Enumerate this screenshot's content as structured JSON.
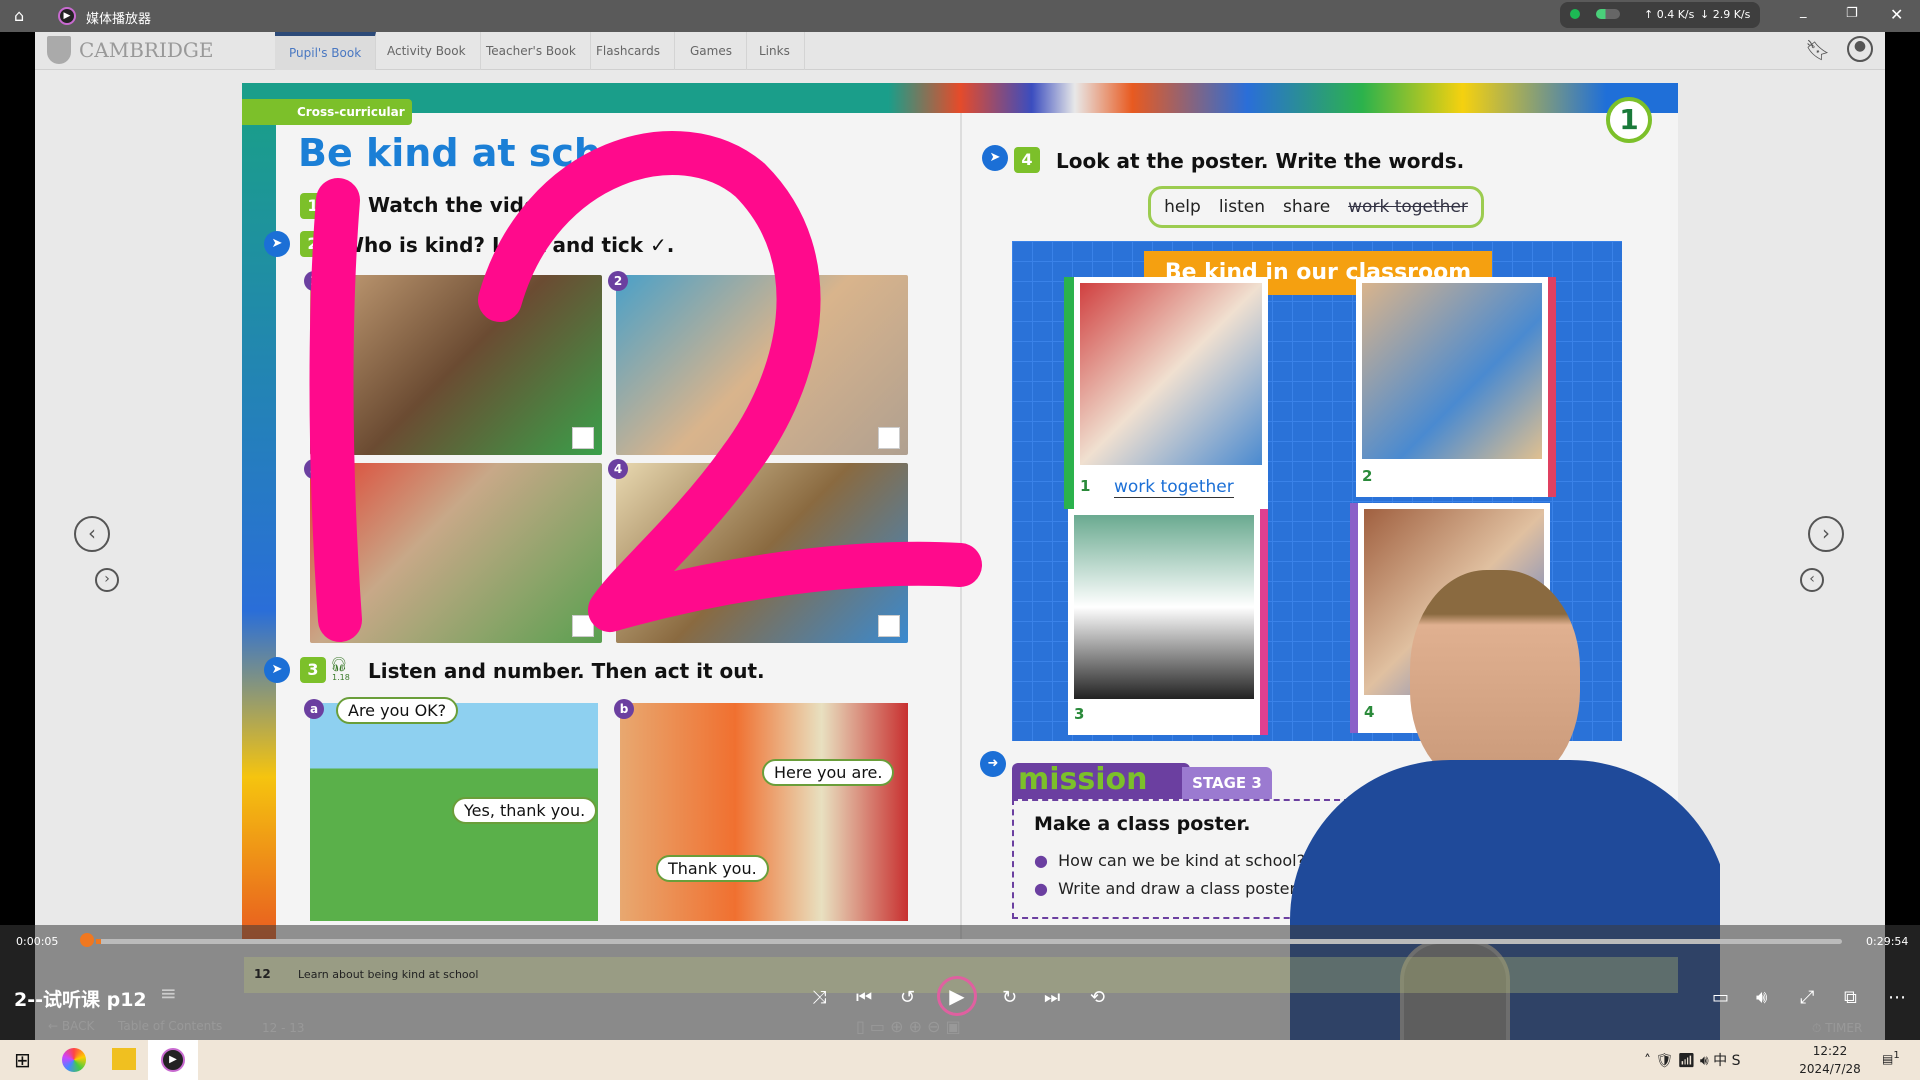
{
  "titlebar": {
    "app_title": "媒体播放器",
    "upload": "0.4",
    "download": "2.9",
    "unit": "K/s"
  },
  "header": {
    "logo": "CAMBRIDGE",
    "tabs": [
      {
        "label": "Pupil's Book",
        "active": true
      },
      {
        "label": "Activity Book"
      },
      {
        "label": "Teacher's Book"
      },
      {
        "label": "Flashcards"
      },
      {
        "label": "Games"
      },
      {
        "label": "Links"
      }
    ]
  },
  "book": {
    "left": {
      "tag": "Cross-curricular",
      "title": "Be kind at scho",
      "ex1": "Watch the video",
      "ex1_num": "1",
      "ex2": "Who is kind? Look and tick ✓.",
      "ex2_num": "2",
      "photos": [
        "1",
        "2",
        "3",
        "4"
      ],
      "ex3_num": "3",
      "ex3_audio": "1.18",
      "ex3": "Listen and number. Then act it out.",
      "scene_a": {
        "label": "a",
        "bubbles": [
          "Are you OK?",
          "Yes, thank you."
        ]
      },
      "scene_b": {
        "label": "b",
        "bubbles": [
          "Here you are.",
          "Thank you."
        ]
      },
      "page_number": "12",
      "footer": "Learn about being kind at school"
    },
    "right": {
      "unit_badge": "1",
      "ex4_num": "4",
      "ex4": "Look at the poster. Write the words.",
      "words": [
        "help",
        "listen",
        "share",
        "work together"
      ],
      "struck_word": "work together",
      "poster_title": "Be kind in our classroom",
      "poster_items": [
        {
          "n": "1",
          "answer": "work together"
        },
        {
          "n": "2",
          "answer": ""
        },
        {
          "n": "3",
          "answer": ""
        },
        {
          "n": "4",
          "answer": ""
        }
      ],
      "mission": "mission",
      "stage": "STAGE 3",
      "mission_title": "Make a class poster.",
      "mission_bullets": [
        "How can we be kind at school? Say",
        "Write and draw a class poster."
      ]
    }
  },
  "annotation": "12",
  "player": {
    "elapsed": "0:00:05",
    "duration": "0:29:54",
    "progress_percent": 0.3,
    "video_title": "2--试听课 p12"
  },
  "viewer_toolbar": {
    "back": "BACK",
    "toc": "Table of Contents",
    "pages": "12 - 13",
    "timer": "TIMER"
  },
  "taskbar": {
    "time": "12:22",
    "date": "2024/7/28",
    "notif": "1"
  },
  "colors": {
    "accent": "#1b7fd6",
    "annotation": "#ff0a8c",
    "green": "#7cc02a",
    "purple": "#6b3fa0"
  }
}
